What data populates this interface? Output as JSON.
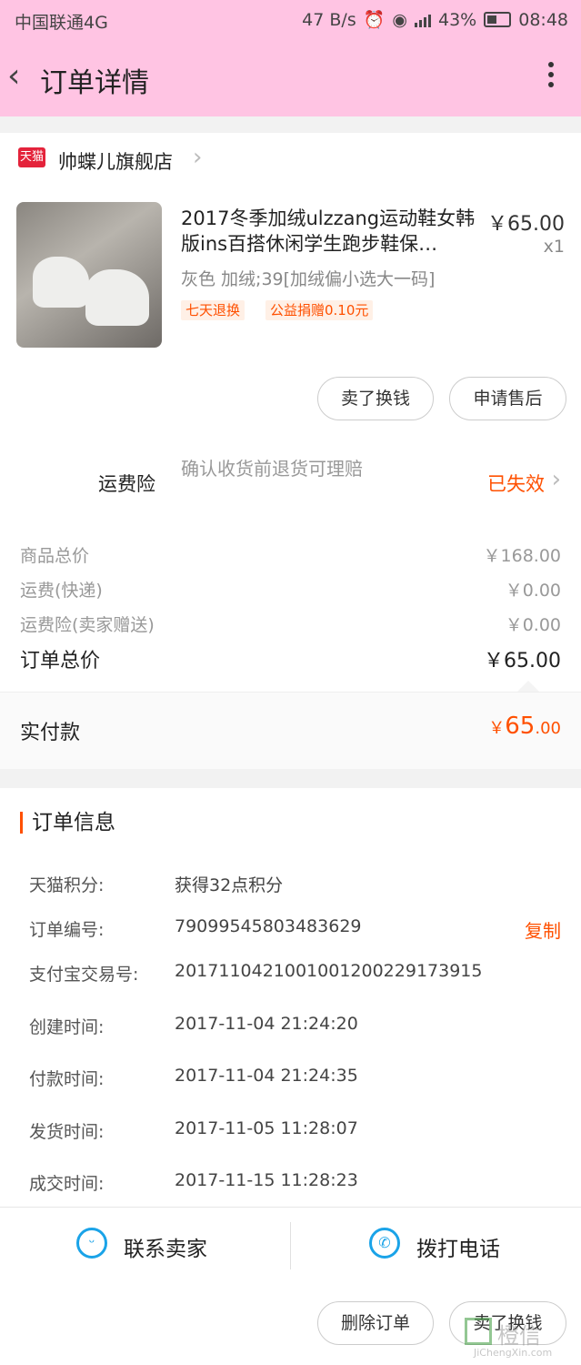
{
  "status_bar": {
    "carrier": "中国联通4G",
    "speed": "47 B/s",
    "battery": "43%",
    "time": "08:48"
  },
  "header": {
    "title": "订单详情"
  },
  "shop": {
    "badge": "天猫",
    "name": "帅蝶儿旗舰店"
  },
  "product": {
    "name": "2017冬季加绒ulzzang运动鞋女韩版ins百搭休闲学生跑步鞋保…",
    "price": "￥65.00",
    "qty": "x1",
    "sku": "灰色 加绒;39[加绒偏小选大一码]",
    "tags": [
      "七天退换",
      "公益捐赠0.10元"
    ]
  },
  "item_actions": {
    "sell": "卖了换钱",
    "after_sale": "申请售后"
  },
  "insurance": {
    "label": "运费险",
    "desc": "确认收货前退货可理赔",
    "status": "已失效"
  },
  "prices": [
    {
      "label": "商品总价",
      "value": "￥168.00"
    },
    {
      "label": "运费(快递)",
      "value": "￥0.00"
    },
    {
      "label": "运费险(卖家赠送)",
      "value": "￥0.00"
    }
  ],
  "total": {
    "label": "订单总价",
    "value": "￥65.00"
  },
  "paid": {
    "label": "实付款",
    "currency": "￥",
    "integer": "65",
    "decimal": ".00"
  },
  "order_info": {
    "title": "订单信息",
    "copy_label": "复制",
    "rows": [
      {
        "label": "天猫积分:",
        "value": "获得32点积分"
      },
      {
        "label": "订单编号:",
        "value": "79099545803483629"
      },
      {
        "label": "支付宝交易号:",
        "value": "2017110421001001200229173915"
      },
      {
        "label": "创建时间:",
        "value": "2017-11-04 21:24:20"
      },
      {
        "label": "付款时间:",
        "value": "2017-11-04 21:24:35"
      },
      {
        "label": "发货时间:",
        "value": "2017-11-05 11:28:07"
      },
      {
        "label": "成交时间:",
        "value": "2017-11-15 11:28:23"
      }
    ]
  },
  "contact": {
    "seller": "联系卖家",
    "call": "拨打电话"
  },
  "bottom_actions": {
    "delete": "删除订单",
    "sell": "卖了换钱"
  },
  "watermark": {
    "text": "橙信",
    "url": "JiChengXin.com"
  },
  "colors": {
    "header_bg": "#ffc4e3",
    "accent": "#ff5000",
    "contact_icon": "#1aa3e8"
  },
  "icons": [
    "back-arrow-icon",
    "more-vertical-icon",
    "tmall-icon",
    "chevron-right-icon",
    "chat-face-icon",
    "phone-icon"
  ]
}
